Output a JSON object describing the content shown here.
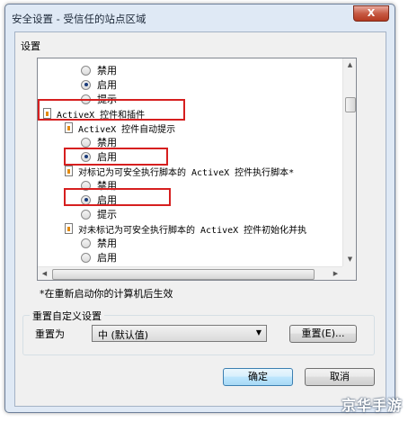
{
  "window": {
    "title": "安全设置 - 受信任的站点区域",
    "close_label": "X"
  },
  "settings_label": "设置",
  "tree": [
    {
      "type": "radio",
      "label": "禁用",
      "checked": false
    },
    {
      "type": "radio",
      "label": "启用",
      "checked": true
    },
    {
      "type": "radio",
      "label": "提示",
      "checked": false
    },
    {
      "type": "category",
      "label": "ActiveX 控件和插件"
    },
    {
      "type": "subcategory",
      "label": "ActiveX 控件自动提示"
    },
    {
      "type": "radio",
      "label": "禁用",
      "checked": false
    },
    {
      "type": "radio",
      "label": "启用",
      "checked": true
    },
    {
      "type": "subcategory",
      "label": "对标记为可安全执行脚本的 ActiveX 控件执行脚本*"
    },
    {
      "type": "radio",
      "label": "禁用",
      "checked": false
    },
    {
      "type": "radio",
      "label": "启用",
      "checked": true
    },
    {
      "type": "radio",
      "label": "提示",
      "checked": false
    },
    {
      "type": "subcategory",
      "label": "对未标记为可安全执行脚本的 ActiveX 控件初始化并执"
    },
    {
      "type": "radio",
      "label": "禁用",
      "checked": false
    },
    {
      "type": "radio",
      "label": "启用",
      "checked": false
    },
    {
      "type": "radio",
      "label": "提示",
      "checked": false
    }
  ],
  "restart_note": "*在重新启动你的计算机后生效",
  "reset_group": {
    "legend": "重置自定义设置",
    "label": "重置为",
    "selected": "中 (默认值)",
    "reset_button": "重置(E)..."
  },
  "ok_button": "确定",
  "cancel_button": "取消",
  "watermark": "京华手游"
}
